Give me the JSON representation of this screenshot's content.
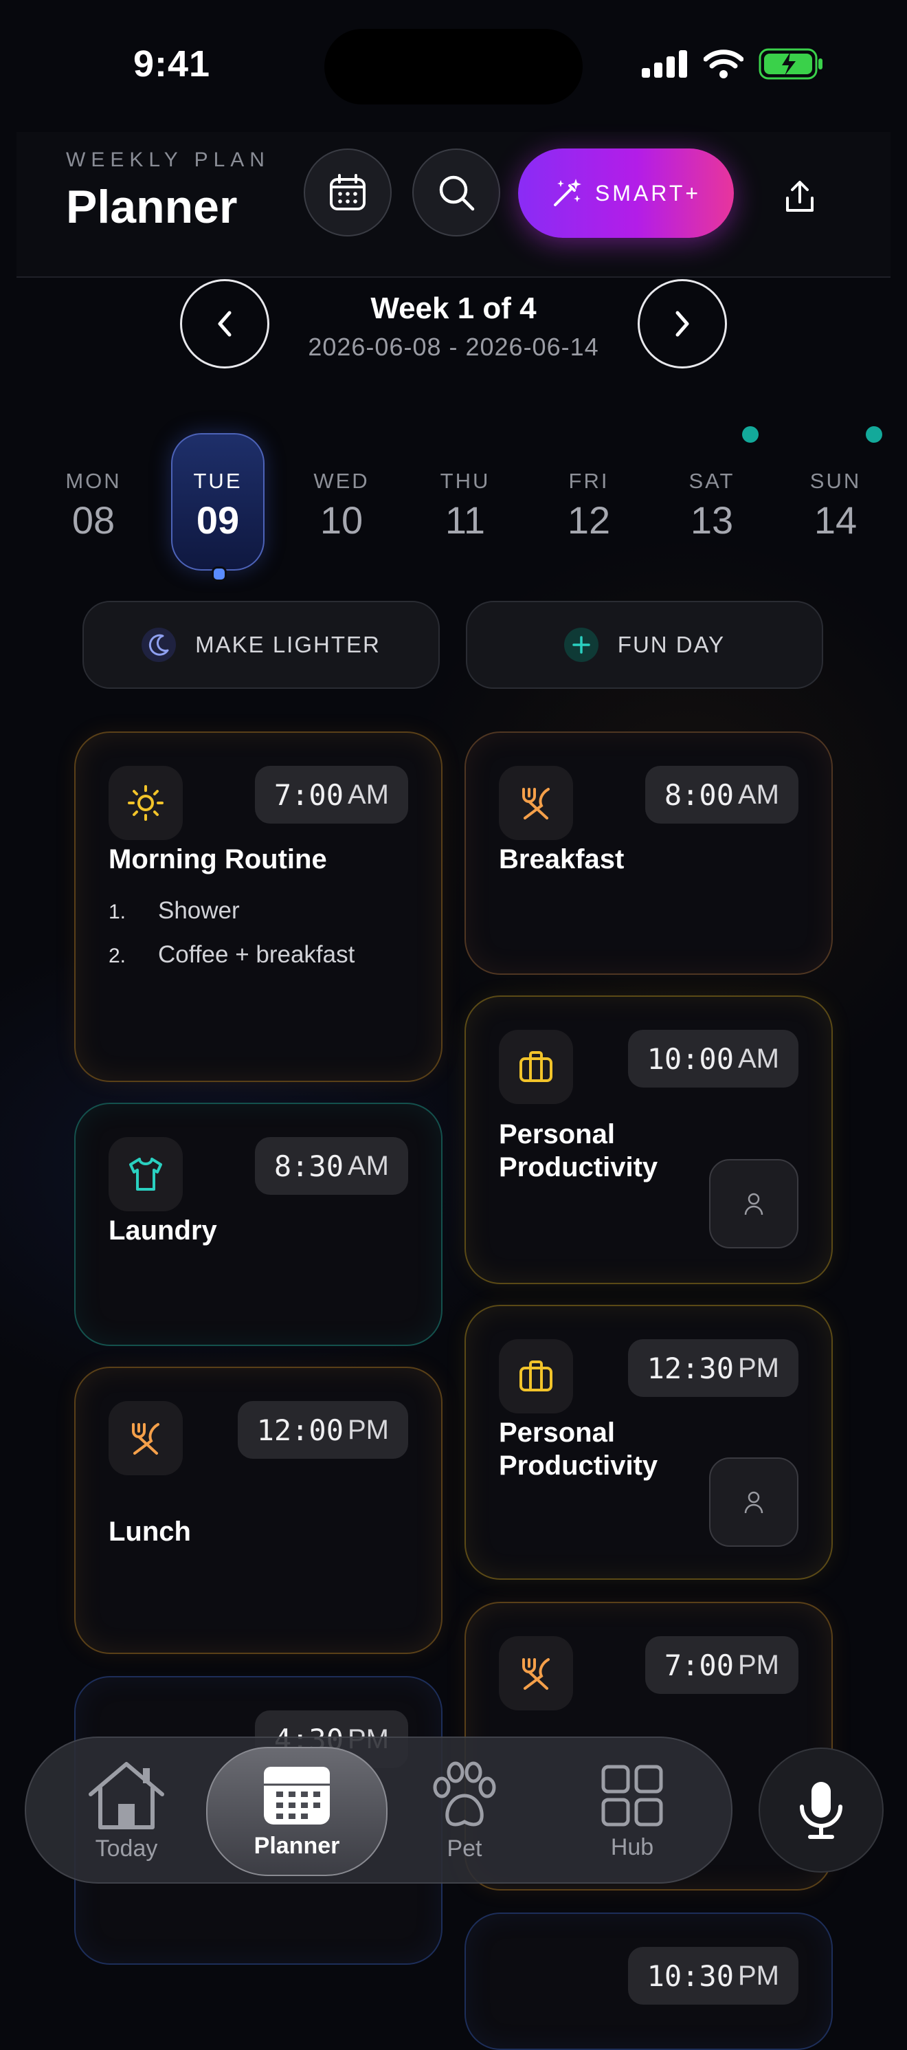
{
  "status": {
    "time": "9:41"
  },
  "header": {
    "eyebrow": "WEEKLY PLAN",
    "title": "Planner",
    "smart_label": "SMART+"
  },
  "week": {
    "title": "Week 1 of 4",
    "range": "2026-06-08 - 2026-06-14"
  },
  "days": [
    {
      "name": "MON",
      "date": "08"
    },
    {
      "name": "TUE",
      "date": "09",
      "selected": true
    },
    {
      "name": "WED",
      "date": "10"
    },
    {
      "name": "THU",
      "date": "11"
    },
    {
      "name": "FRI",
      "date": "12"
    },
    {
      "name": "SAT",
      "date": "13",
      "has_event": true
    },
    {
      "name": "SUN",
      "date": "14",
      "has_event": true
    }
  ],
  "actions": {
    "lighter": "MAKE LIGHTER",
    "fun": "FUN DAY"
  },
  "cards": {
    "morning": {
      "title": "Morning Routine",
      "time": "7:00",
      "ampm": "AM",
      "icon": "sun-icon",
      "items": [
        "Shower",
        "Coffee + breakfast"
      ],
      "nums": [
        "1.",
        "2."
      ]
    },
    "breakfast": {
      "title": "Breakfast",
      "time": "8:00",
      "ampm": "AM",
      "icon": "utensils-icon"
    },
    "productivity1": {
      "title_line1": "Personal",
      "title_line2": "Productivity",
      "time": "10:00",
      "ampm": "AM",
      "icon": "briefcase-icon"
    },
    "laundry": {
      "title": "Laundry",
      "time": "8:30",
      "ampm": "AM",
      "icon": "shirt-icon"
    },
    "productivity2": {
      "title_line1": "Personal",
      "title_line2": "Productivity",
      "time": "12:30",
      "ampm": "PM",
      "icon": "briefcase-icon"
    },
    "lunch": {
      "title": "Lunch",
      "time": "12:00",
      "ampm": "PM",
      "icon": "utensils-icon"
    },
    "evening": {
      "time": "7:00",
      "ampm": "PM",
      "icon": "utensils-icon"
    },
    "partial_left": {
      "time": "4:30",
      "ampm": "PM"
    },
    "partial_right": {
      "time": "10:30",
      "ampm": "PM"
    }
  },
  "nav": {
    "today": "Today",
    "planner": "Planner",
    "pet": "Pet",
    "hub": "Hub"
  },
  "colors": {
    "accent_purple": "#8a2cf5",
    "accent_pink": "#e8359c",
    "orange": "#f5a04a",
    "gold": "#f2c42a",
    "teal": "#2ad0c0",
    "selected_day": "#1e2f6a"
  }
}
